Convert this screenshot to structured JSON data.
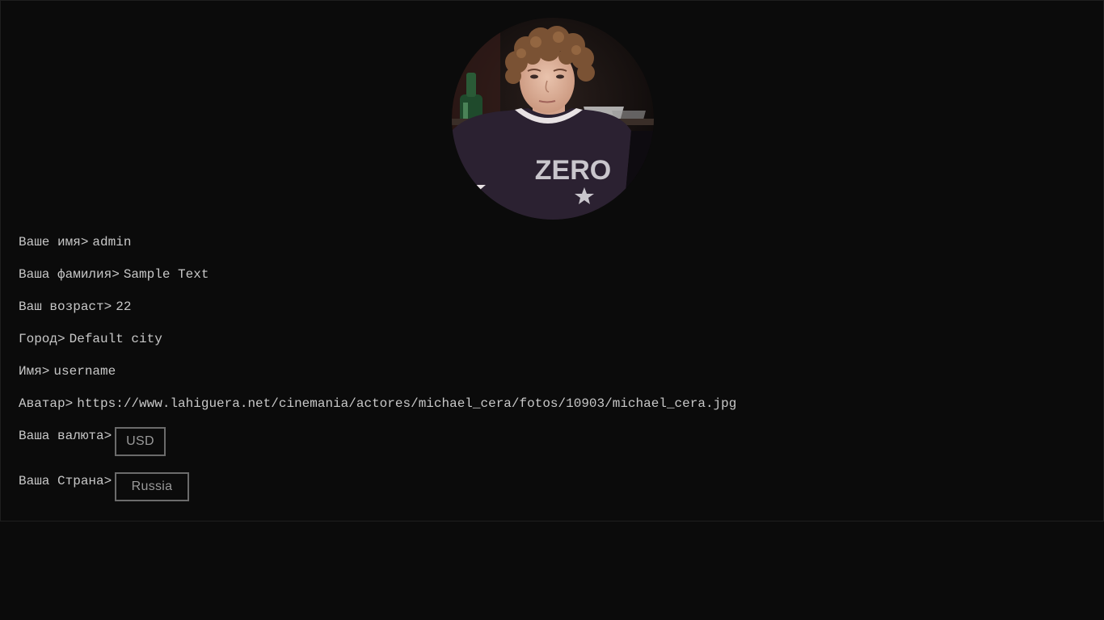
{
  "avatar": {
    "shirt_text": "ZERO"
  },
  "profile": {
    "first_name_label": "Ваше имя>",
    "first_name_value": "admin",
    "last_name_label": "Ваша фамилия>",
    "last_name_value": "Sample Text",
    "age_label": "Ваш возраст>",
    "age_value": "22",
    "city_label": "Город>",
    "city_value": "Default city",
    "username_label": "Имя>",
    "username_value": "username",
    "avatar_label": "Аватар>",
    "avatar_value": "https://www.lahiguera.net/cinemania/actores/michael_cera/fotos/10903/michael_cera.jpg",
    "currency_label": "Ваша валюта>",
    "currency_value": "USD",
    "country_label": "Ваша Страна>",
    "country_value": "Russia"
  },
  "colors": {
    "background": "#0b0b0b",
    "text": "#c8c8c8",
    "select_border": "#6b6b6b",
    "select_text": "#9a9a9a"
  }
}
